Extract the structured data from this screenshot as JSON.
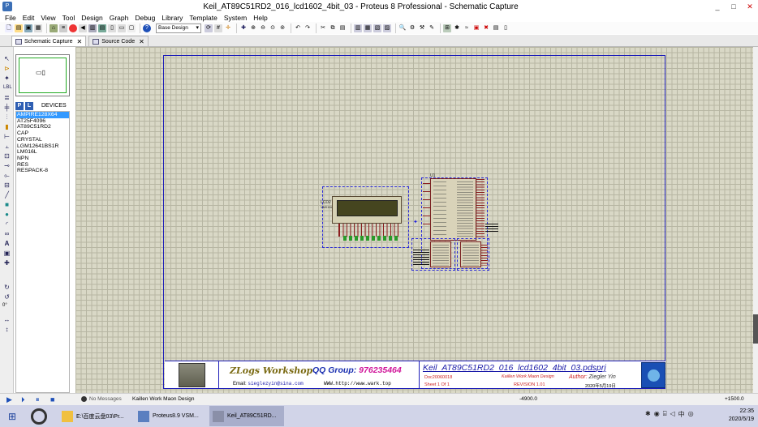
{
  "window": {
    "title": "Keil_AT89C51RD2_016_lcd1602_4bit_03 - Proteus 8 Professional - Schematic Capture",
    "controls": [
      "_",
      "□",
      "✕"
    ]
  },
  "menu": [
    "File",
    "Edit",
    "View",
    "Tool",
    "Design",
    "Graph",
    "Debug",
    "Library",
    "Template",
    "System",
    "Help"
  ],
  "toolbar": {
    "design_selector": "Base Design"
  },
  "tabs": [
    {
      "label": "Schematic Capture",
      "active": true
    },
    {
      "label": "Source Code",
      "active": false
    }
  ],
  "devices": {
    "mode_p": "P",
    "mode_l": "L",
    "header": "DEVICES",
    "items": [
      "AMPIRE128X64",
      "AT25F4096",
      "AT89C51RD2",
      "CAP",
      "CRYSTAL",
      "LGM12641BS1R",
      "LM016L",
      "NPN",
      "RES",
      "RESPACK-8"
    ],
    "selected_index": 0
  },
  "rotation": "0°",
  "schematic": {
    "lcd_ref": "LCD2",
    "lcd_model": "VM016L",
    "mcu_ref": "U1",
    "mcu_model": "AT89C51RD2"
  },
  "title_block": {
    "logo_text": "ZLogs Workshop",
    "qq_label": "QQ Group:",
    "qq_number": "976235464",
    "email_label": "Email:",
    "email": "sieglezyin@sina.com",
    "website": "WWW.http://www.wark.top",
    "project": "Keil_AT89C51RD2_016_lcd1602_4bit_03.pdsprj",
    "doc_id": "Doc20060018",
    "sheet": "Sheet  1    Of  1",
    "keywords": "Kaillen Work Maon Design",
    "author_label": "Author:",
    "author": "Ziegler Yin",
    "revision": "REVISION  1.01",
    "date": "2020年5月19日"
  },
  "status": {
    "messages": "No Messages",
    "design": "Kaillen Work Maon Design",
    "x": "-4900.0",
    "y": "+1500.0"
  },
  "taskbar": {
    "items": [
      {
        "label": "E:\\百度云盘03\\Pr..."
      },
      {
        "label": "Proteus8.9 VSM..."
      },
      {
        "label": "Keil_AT89C51RD..."
      }
    ],
    "tray_ime": "中",
    "time": "22:35",
    "date": "2020/5/19"
  }
}
